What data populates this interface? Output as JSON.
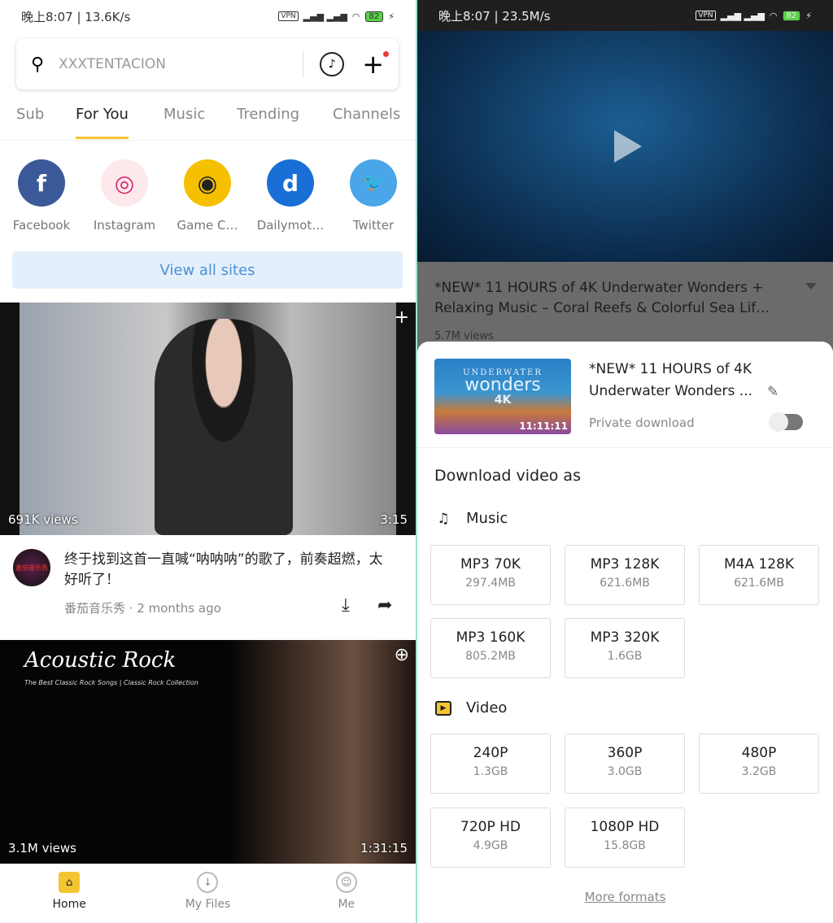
{
  "left": {
    "status": {
      "time": "晚上8:07 | 13.6K/s",
      "battery": "82"
    },
    "search": {
      "placeholder": "XXXTENTACION"
    },
    "tabs": [
      {
        "label": "Sub"
      },
      {
        "label": "For You"
      },
      {
        "label": "Music"
      },
      {
        "label": "Trending"
      },
      {
        "label": "Channels"
      }
    ],
    "active_tab": "For You",
    "sites": [
      {
        "label": "Facebook",
        "glyph": "f",
        "color": "#3b5998"
      },
      {
        "label": "Instagram",
        "glyph": "◎",
        "color": "#fde8ec"
      },
      {
        "label": "Game C…",
        "glyph": "◉",
        "color": "#f4c000"
      },
      {
        "label": "Dailymot…",
        "glyph": "d",
        "color": "#1a6fd6"
      },
      {
        "label": "Twitter",
        "glyph": "🐦",
        "color": "#4aa6e8"
      }
    ],
    "view_all": "View all sites",
    "video1": {
      "views": "691K views",
      "duration": "3:15",
      "title": "终于找到这首一直喊“呐呐呐”的歌了，前奏超燃，太好听了！",
      "channel_avatar": "番茄音乐秀",
      "channel": "番茄音乐秀 · 2 months ago"
    },
    "video2": {
      "art_title": "Acoustic Rock",
      "art_subtitle": "The Best Classic Rock Songs | Classic Rock Collection",
      "views": "3.1M views",
      "duration": "1:31:15"
    },
    "nav": [
      {
        "label": "Home",
        "icon": "home-icon"
      },
      {
        "label": "My Files",
        "icon": "download-icon"
      },
      {
        "label": "Me",
        "icon": "face-icon"
      }
    ]
  },
  "right": {
    "status": {
      "time": "晚上8:07 | 23.5M/s",
      "battery": "82"
    },
    "video": {
      "title": "*NEW* 11 HOURS of 4K Underwater Wonders + Relaxing Music – Coral Reefs & Colorful Sea Lif…",
      "views": "5.7M views"
    },
    "sheet": {
      "thumb": {
        "line1": "UNDERWATER",
        "line2": "wonders",
        "line3": "4K",
        "duration": "11:11:11"
      },
      "title": "*NEW* 11 HOURS of 4K Underwater Wonders ...",
      "private_label": "Private download",
      "private_on": false,
      "heading": "Download video as",
      "music_label": "Music",
      "music": [
        {
          "q": "MP3 70K",
          "s": "297.4MB"
        },
        {
          "q": "MP3 128K",
          "s": "621.6MB"
        },
        {
          "q": "M4A 128K",
          "s": "621.6MB"
        },
        {
          "q": "MP3 160K",
          "s": "805.2MB"
        },
        {
          "q": "MP3 320K",
          "s": "1.6GB"
        }
      ],
      "video_label": "Video",
      "video": [
        {
          "q": "240P",
          "s": "1.3GB"
        },
        {
          "q": "360P",
          "s": "3.0GB"
        },
        {
          "q": "480P",
          "s": "3.2GB"
        },
        {
          "q": "720P HD",
          "s": "4.9GB"
        },
        {
          "q": "1080P HD",
          "s": "15.8GB"
        }
      ],
      "more": "More formats"
    }
  }
}
